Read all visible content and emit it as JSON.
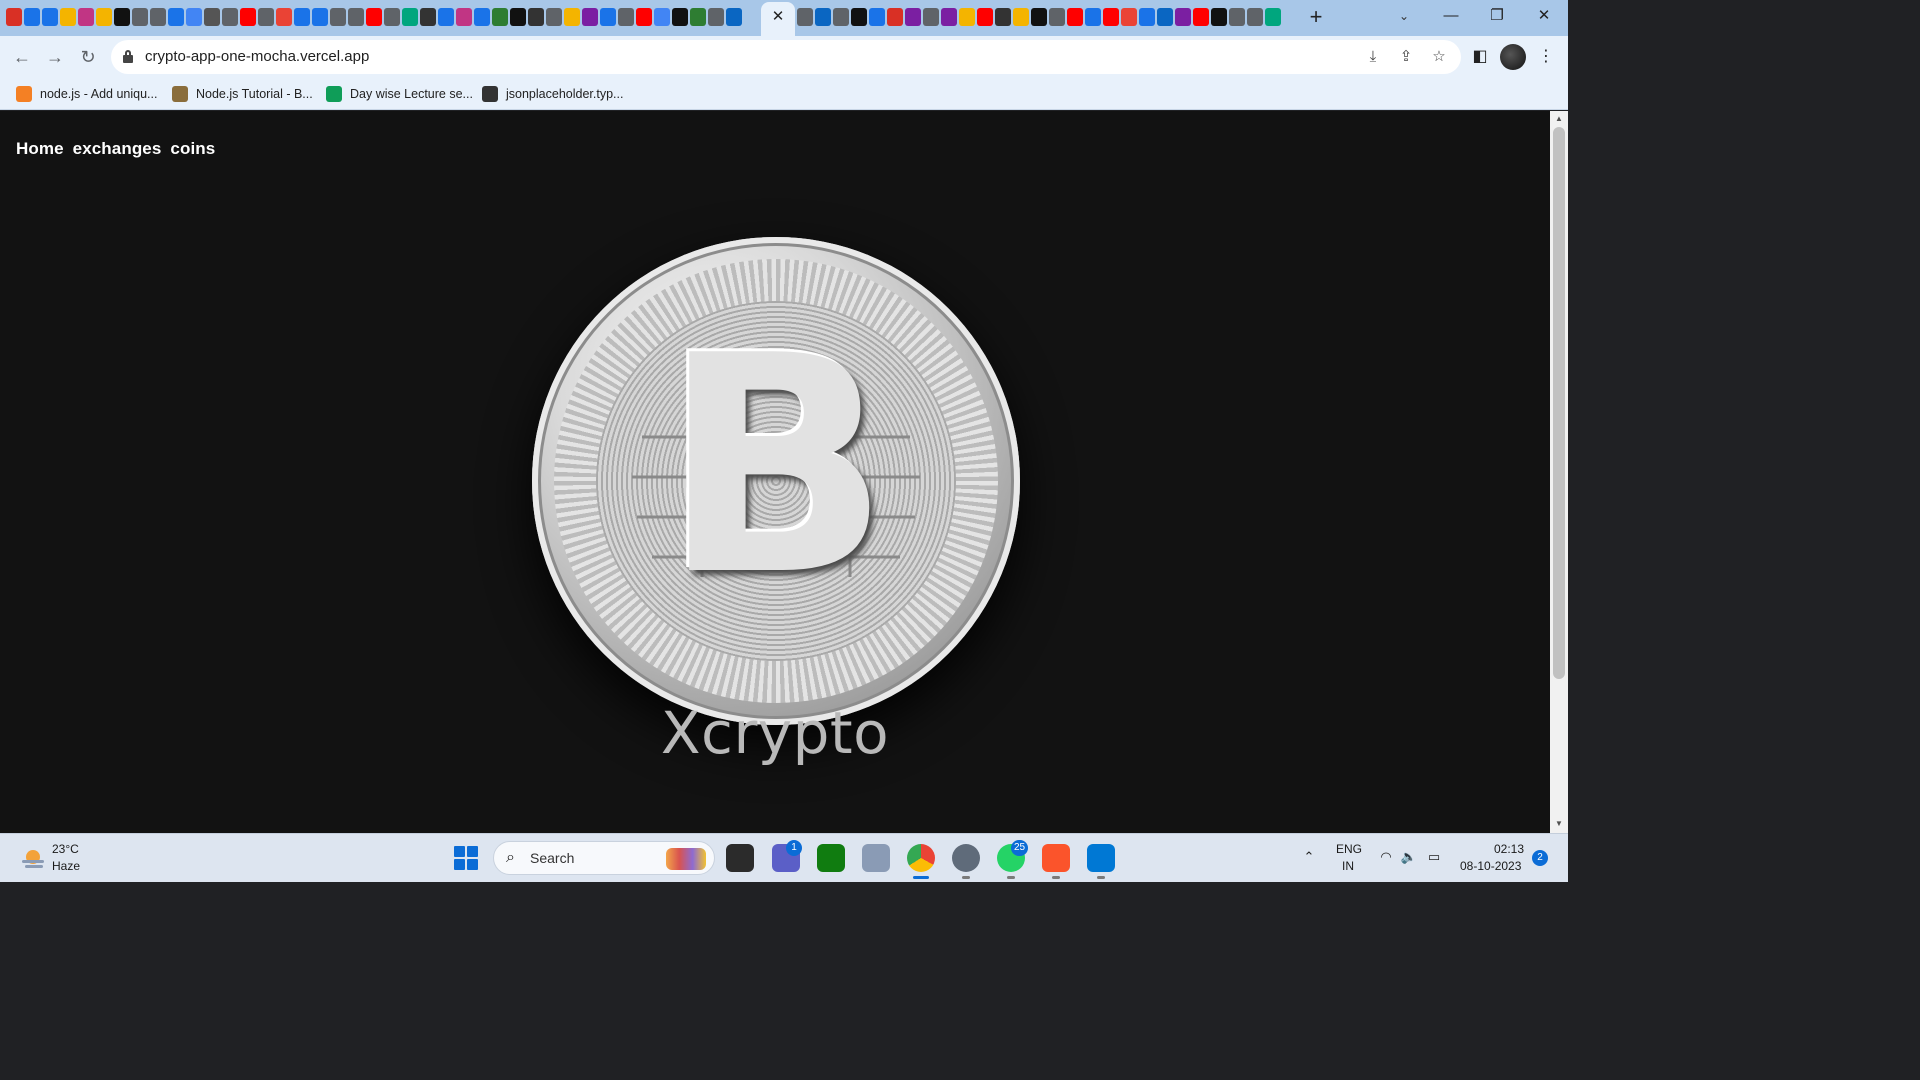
{
  "browser": {
    "tab_close_glyph": "✕",
    "new_tab_glyph": "+",
    "tab_search_glyph": "⌄",
    "window_controls": {
      "minimize": "—",
      "restore": "❐",
      "close": "✕"
    },
    "tab_favicon_colors": [
      "#d93025",
      "#1a73e8",
      "#1a73e8",
      "#f4b400",
      "#c13584",
      "#f4b400",
      "#111111",
      "#5f6368",
      "#5f6368",
      "#1a73e8",
      "#4285f4",
      "#555555",
      "#5f6368",
      "#ff0000",
      "#5f6368",
      "#ea4335",
      "#1a73e8",
      "#1a73e8",
      "#5f6368",
      "#5f6368",
      "#ff0000",
      "#5f6368",
      "#00a67e",
      "#333333",
      "#1a73e8",
      "#c13584",
      "#1a73e8",
      "#2e7d32",
      "#111111",
      "#333333",
      "#5f6368",
      "#f4b400",
      "#7b1fa2",
      "#1a73e8",
      "#5f6368",
      "#ff0000",
      "#4285f4",
      "#111111",
      "#2e7d32",
      "#5f6368",
      "#0a66c2"
    ],
    "tab_favicon_colors_right": [
      "#5f6368",
      "#0a66c2",
      "#5f6368",
      "#111111",
      "#1a73e8",
      "#d93025",
      "#7b1fa2",
      "#5f6368",
      "#7b1fa2",
      "#f4b400",
      "#ff0000",
      "#333333",
      "#f4b400",
      "#111111",
      "#5f6368",
      "#ff0000",
      "#1a73e8",
      "#ff0000",
      "#ea4335",
      "#1a73e8",
      "#0a66c2",
      "#7b1fa2",
      "#ff0000",
      "#111111",
      "#5f6368",
      "#5f6368",
      "#00a67e"
    ],
    "nav": {
      "back": "←",
      "forward": "→",
      "reload": "↻"
    },
    "url": "crypto-app-one-mocha.vercel.app",
    "omnibox_icons": {
      "install": "⤓",
      "share": "⇪",
      "bookmark": "☆"
    },
    "sidepanel_glyph": "◧",
    "menu_glyph": "⋮",
    "bookmarks": [
      {
        "label": "node.js - Add uniqu...",
        "icon": "stackoverflow-icon",
        "color": "#f48024"
      },
      {
        "label": "Node.js Tutorial - B...",
        "icon": "bookmark-site-icon",
        "color": "#8a6d3b"
      },
      {
        "label": "Day wise Lecture se...",
        "icon": "google-sheets-icon",
        "color": "#0f9d58"
      },
      {
        "label": "jsonplaceholder.typ...",
        "icon": "jsonplaceholder-icon",
        "color": "#333333"
      }
    ]
  },
  "page": {
    "nav_links": [
      "Home",
      "exchanges",
      "coins"
    ],
    "brand": "Xcrypto",
    "coin_symbol": "B",
    "coin_colors": {
      "face": "#d9d9d9",
      "highlight": "#fafafa",
      "shadow": "#7d7d7d"
    },
    "background_color": "#121212"
  },
  "scrollbar": {
    "up": "▲",
    "down": "▼"
  },
  "taskbar": {
    "weather": {
      "temp": "23°C",
      "desc": "Haze"
    },
    "search_label": "Search",
    "search_glyph": "⌕",
    "apps": [
      {
        "name": "file-explorer",
        "badge": ""
      },
      {
        "name": "teams",
        "badge": "1"
      },
      {
        "name": "xbox",
        "badge": ""
      },
      {
        "name": "app-generic",
        "badge": ""
      },
      {
        "name": "chrome",
        "badge": ""
      },
      {
        "name": "settings",
        "badge": ""
      },
      {
        "name": "whatsapp",
        "badge": "25"
      },
      {
        "name": "brave",
        "badge": ""
      },
      {
        "name": "vscode",
        "badge": ""
      }
    ],
    "tray": {
      "chevron": "⌃",
      "lang_line1": "ENG",
      "lang_line2": "IN",
      "wifi": "◠",
      "volume": "🔈",
      "battery": "▭",
      "time": "02:13",
      "date": "08-10-2023",
      "notifications": "2"
    }
  }
}
